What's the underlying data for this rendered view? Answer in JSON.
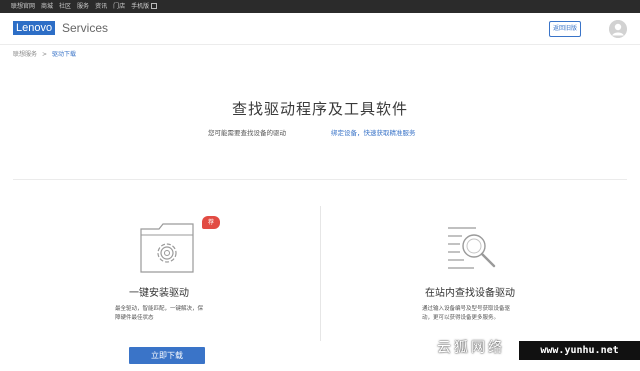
{
  "topbar": {
    "links": [
      "联想官网",
      "商城",
      "社区",
      "服务",
      "资讯",
      "门店",
      "手机版"
    ]
  },
  "header": {
    "logo_text": "Lenovo",
    "services_text": "Services",
    "old_version_button": "返回旧版",
    "brand_color": "#2d6ec6"
  },
  "breadcrumb": {
    "home": "联想服务",
    "separator": ">",
    "current": "驱动下载"
  },
  "main": {
    "title": "查找驱动程序及工具软件",
    "subtitle": "您可能需要查找设备的驱动",
    "link": "绑定设备，快速获取精准服务"
  },
  "cards": {
    "install": {
      "icon": "folder-gear-icon",
      "badge": "荐",
      "title": "一键安装驱动",
      "desc_line1": "最全驱动，智能匹配，一键解决，保",
      "desc_line2": "障硬件最佳状态",
      "button": "立即下载"
    },
    "search": {
      "icon": "document-search-icon",
      "title": "在站内查找设备驱动",
      "desc_line1": "通过输入设备编号及型号获取设备驱",
      "desc_line2": "动，更可以获得设备更多服务。"
    }
  },
  "watermark": {
    "cn": "云狐网络",
    "url": "www.yunhu.net"
  },
  "colors": {
    "accent": "#3a74c8",
    "badge": "#e24b43",
    "topbar": "#2b2b2b"
  }
}
